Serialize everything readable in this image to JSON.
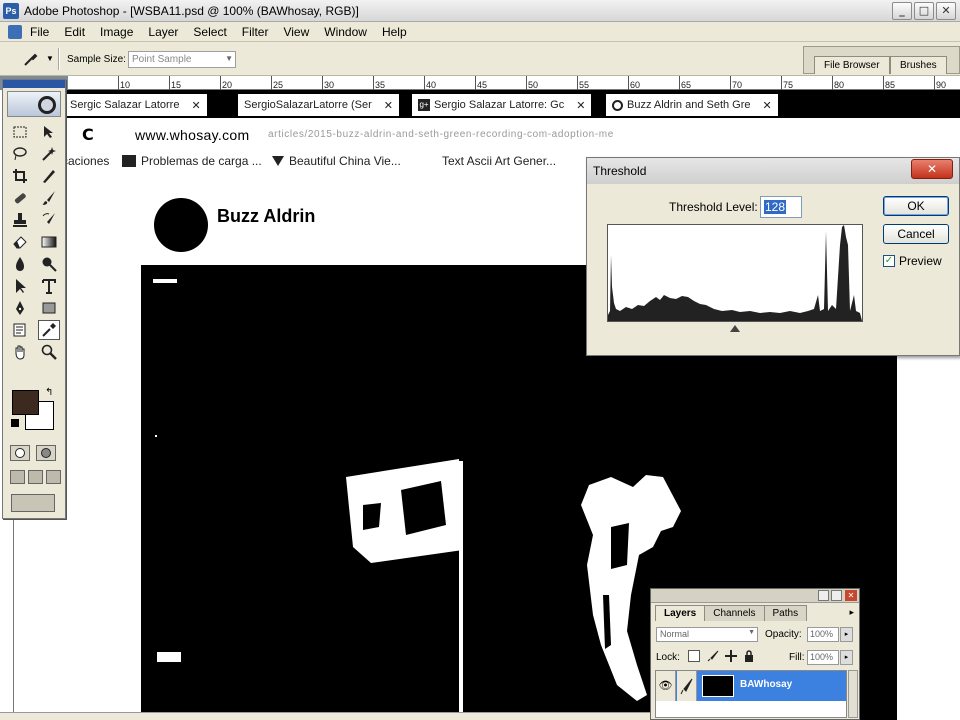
{
  "window": {
    "title": "Adobe Photoshop - [WSBA11.psd @ 100% (BAWhosay, RGB)]",
    "logo_text": "Ps",
    "minimize": "_",
    "maximize": "□",
    "close": "✕"
  },
  "menu": {
    "items": [
      "File",
      "Edit",
      "Image",
      "Layer",
      "Select",
      "Filter",
      "View",
      "Window",
      "Help"
    ]
  },
  "options": {
    "sample_size_label": "Sample Size:",
    "sample_size_value": "Point Sample",
    "palette_well_tabs": [
      "File Browser",
      "Brushes"
    ]
  },
  "ruler": {
    "ticks": [
      "10",
      "15",
      "20",
      "25",
      "30",
      "35",
      "40",
      "45",
      "50",
      "55",
      "60",
      "65",
      "70",
      "75",
      "80",
      "85",
      "90"
    ]
  },
  "toolbox": {
    "foreground_color": "#3c2a21",
    "background_color": "#ffffff",
    "tools": [
      "marquee-icon",
      "move-icon",
      "lasso-icon",
      "magic-wand-icon",
      "crop-icon",
      "slice-icon",
      "healing-brush-icon",
      "brush-icon",
      "clone-stamp-icon",
      "history-brush-icon",
      "eraser-icon",
      "gradient-icon",
      "blur-icon",
      "dodge-icon",
      "path-select-icon",
      "type-icon",
      "pen-icon",
      "shape-icon",
      "notes-icon",
      "eyedropper-icon",
      "hand-icon",
      "zoom-icon"
    ]
  },
  "browser": {
    "tabs": [
      {
        "title": "Sergic Salazar Latorre"
      },
      {
        "title": "SergioSalazarLatorre (Ser"
      },
      {
        "title": "Sergio Salazar Latorre: Gc"
      },
      {
        "title": "Buzz Aldrin and Seth Gre"
      }
    ],
    "tab_close": "✕",
    "reload": "C",
    "url_host": "www.whosay.com",
    "url_path": "articles/2015-buzz-aldrin-and-seth-green-recording-com-adoption-me",
    "bookmarks": [
      "caciones",
      "Problemas de carga ...",
      "Beautiful China Vie...",
      "Text Ascii Art Gener..."
    ]
  },
  "profile": {
    "name": "Buzz Aldrin"
  },
  "threshold": {
    "title": "Threshold",
    "close": "✕",
    "level_label": "Threshold Level:",
    "level_value": "128",
    "ok": "OK",
    "cancel": "Cancel",
    "preview_label": "Preview",
    "preview_checked": true,
    "check_glyph": "✓"
  },
  "layers": {
    "tabs": [
      "Layers",
      "Channels",
      "Paths"
    ],
    "blend_mode": "Normal",
    "opacity_label": "Opacity:",
    "opacity_value": "100%",
    "lock_label": "Lock:",
    "fill_label": "Fill:",
    "fill_value": "100%",
    "menu_arrow": "▸",
    "rows": [
      {
        "name": "BAWhosay",
        "visible": true,
        "selected": true
      }
    ],
    "eye_glyph": "👁"
  }
}
